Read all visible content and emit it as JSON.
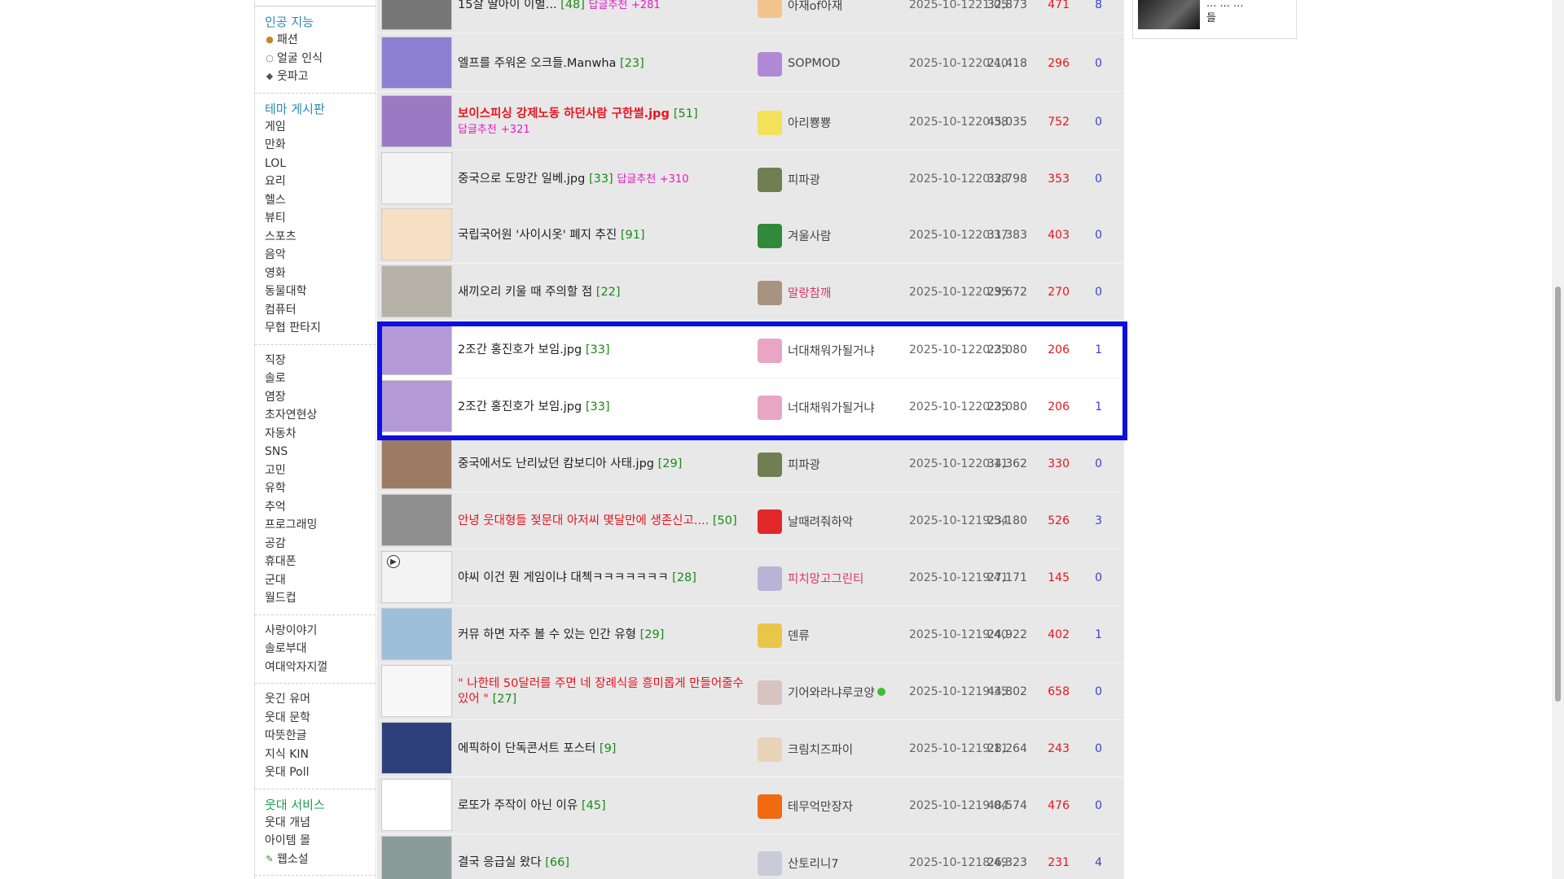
{
  "sidebar": {
    "sections": [
      {
        "title": "인공 지능",
        "title_color": "#2a8ab6",
        "items": [
          {
            "label": "패션",
            "icon": "person-icon"
          },
          {
            "label": "얼굴 인식",
            "icon": "face-outline-icon"
          },
          {
            "label": "웃파고",
            "icon": "ai-icon"
          }
        ]
      },
      {
        "title": "테마 게시판",
        "title_color": "#2a8ab6",
        "items": [
          {
            "label": "게임"
          },
          {
            "label": "만화"
          },
          {
            "label": "LOL"
          },
          {
            "label": "요리"
          },
          {
            "label": "헬스"
          },
          {
            "label": "뷰티"
          },
          {
            "label": "스포츠"
          },
          {
            "label": "음악"
          },
          {
            "label": "영화"
          },
          {
            "label": "동물대학"
          },
          {
            "label": "컴퓨터"
          },
          {
            "label": "무협 판타지"
          }
        ]
      },
      {
        "title": "",
        "items": [
          {
            "label": "직장"
          },
          {
            "label": "솔로"
          },
          {
            "label": "염장"
          },
          {
            "label": "초자연현상"
          },
          {
            "label": "자동차"
          },
          {
            "label": "SNS"
          },
          {
            "label": "고민"
          },
          {
            "label": "유학"
          },
          {
            "label": "추억"
          },
          {
            "label": "프로그래밍"
          },
          {
            "label": "공감"
          },
          {
            "label": "휴대폰"
          },
          {
            "label": "군대"
          },
          {
            "label": "월드컵"
          }
        ]
      },
      {
        "title": "",
        "items": [
          {
            "label": "사랑이야기"
          },
          {
            "label": "솔로부대"
          },
          {
            "label": "여대악자지껄"
          }
        ]
      },
      {
        "title": "",
        "items": [
          {
            "label": "웃긴 유머"
          },
          {
            "label": "웃대 문학"
          },
          {
            "label": "따뜻한글"
          },
          {
            "label": "지식 KIN"
          },
          {
            "label": "웃대 Poll"
          }
        ]
      },
      {
        "title": "웃대 서비스",
        "title_color": "#1c9c52",
        "items": [
          {
            "label": "웃대 개념"
          },
          {
            "label": "아이템 몰"
          },
          {
            "label": "웹소설",
            "icon": "pen-icon"
          }
        ]
      }
    ]
  },
  "posts": [
    {
      "title": "15살 딸아이 이별...",
      "comments": "[48]",
      "rec_label": "답글추천",
      "rec_value": "+281",
      "style": "normal",
      "author": "아재of아재",
      "author_style": "normal",
      "date": "2025-10-12",
      "time": "21:05",
      "views": "32,873",
      "recs": "471",
      "opp": "8",
      "thumb": "#777777",
      "avatar": "#f2c48d"
    },
    {
      "title": "엘프를 주워온 오크들.Manwha",
      "comments": "[23]",
      "rec_label": "",
      "rec_value": "",
      "style": "normal",
      "author": "SOPMOD",
      "author_style": "normal",
      "date": "2025-10-12",
      "time": "20:40",
      "views": "21,418",
      "recs": "296",
      "opp": "0",
      "thumb": "#8d7fd1",
      "avatar": "#b089d6"
    },
    {
      "title": "보이스피싱 강제노동 하던사람 구한썰.jpg",
      "comments": "[51]",
      "rec_label": "답글추천",
      "rec_value": "+321",
      "style": "red-bold",
      "author": "아리뿅뿅",
      "author_style": "normal",
      "date": "2025-10-12",
      "time": "20:38",
      "views": "45,035",
      "recs": "752",
      "opp": "0",
      "thumb": "#9a7ac2",
      "avatar": "#f3e15a"
    },
    {
      "title": "중국으로 도망간 일베.jpg",
      "comments": "[33]",
      "rec_label": "답글추천",
      "rec_value": "+310",
      "style": "normal",
      "author": "피파광",
      "author_style": "normal",
      "date": "2025-10-12",
      "time": "20:38",
      "views": "32,798",
      "recs": "353",
      "opp": "0",
      "thumb": "#f4f4f4",
      "avatar": "#6f7f52"
    },
    {
      "title": "국립국어원 '사이시옷' 폐지 추진",
      "comments": "[91]",
      "rec_label": "",
      "rec_value": "",
      "style": "normal",
      "author": "겨울사람",
      "author_style": "normal",
      "date": "2025-10-12",
      "time": "20:37",
      "views": "31,383",
      "recs": "403",
      "opp": "0",
      "thumb": "#f6dfc3",
      "avatar": "#2f8a3a"
    },
    {
      "title": "새끼오리 키울 때 주의할 점",
      "comments": "[22]",
      "rec_label": "",
      "rec_value": "",
      "style": "normal",
      "author": "말랑참깨",
      "author_style": "pink",
      "date": "2025-10-12",
      "time": "20:35",
      "views": "29,672",
      "recs": "270",
      "opp": "0",
      "thumb": "#b7b2a8",
      "avatar": "#a79380"
    },
    {
      "title": "2조간 홍진호가 보임.jpg",
      "comments": "[33]",
      "rec_label": "",
      "rec_value": "",
      "style": "normal",
      "author": "너대채워가될거냐",
      "author_style": "normal",
      "date": "2025-10-12",
      "time": "20:25",
      "views": "23,080",
      "recs": "206",
      "opp": "1",
      "thumb": "#b39ad6",
      "avatar": "#e8a6c4",
      "highlight": true
    },
    {
      "title": "2조간 홍진호가 보임.jpg",
      "comments": "[33]",
      "rec_label": "",
      "rec_value": "",
      "style": "normal",
      "author": "너대채워가될거냐",
      "author_style": "normal",
      "date": "2025-10-12",
      "time": "20:25",
      "views": "23,080",
      "recs": "206",
      "opp": "1",
      "thumb": "#b39ad6",
      "avatar": "#e8a6c4",
      "highlight": true
    },
    {
      "title": "중국에서도 난리났던 캄보디아 사태.jpg",
      "comments": "[29]",
      "rec_label": "",
      "rec_value": "",
      "style": "normal",
      "author": "피파광",
      "author_style": "normal",
      "date": "2025-10-12",
      "time": "20:11",
      "views": "34,362",
      "recs": "330",
      "opp": "0",
      "thumb": "#9c7b62",
      "avatar": "#6f7f52"
    },
    {
      "title": "안녕 웃대형들 젖문대 아저씨 몇달만에 생존신고....",
      "comments": "[50]",
      "rec_label": "",
      "rec_value": "",
      "style": "red",
      "author": "날때려줘하악",
      "author_style": "normal",
      "date": "2025-10-12",
      "time": "19:54",
      "views": "23,180",
      "recs": "526",
      "opp": "3",
      "thumb": "#8e8e8e",
      "avatar": "#e0282b"
    },
    {
      "title": "야씨 이건 뭔 게임이냐 대첵ㅋㅋㅋㅋㅋㅋㅋ",
      "comments": "[28]",
      "rec_label": "",
      "rec_value": "",
      "style": "normal",
      "author": "피치망고그린티",
      "author_style": "pink",
      "date": "2025-10-12",
      "time": "19:41",
      "views": "27,171",
      "recs": "145",
      "opp": "0",
      "thumb": "#f3f3f3",
      "avatar": "#b9b4d6",
      "play": true
    },
    {
      "title": "커뮤 하면 자주 볼 수 있는 인간 유형",
      "comments": "[29]",
      "rec_label": "",
      "rec_value": "",
      "style": "normal",
      "author": "덴류",
      "author_style": "normal",
      "date": "2025-10-12",
      "time": "19:40",
      "views": "24,922",
      "recs": "402",
      "opp": "1",
      "thumb": "#9dbfd9",
      "avatar": "#e9c64a"
    },
    {
      "title": "\" 나한테 50달러를 주면 네 장례식을 흥미롭게 만들어줄수 있어 \"",
      "comments": "[27]",
      "rec_label": "",
      "rec_value": "",
      "style": "red",
      "author": "기어와라냐루코양",
      "author_style": "normal",
      "date": "2025-10-12",
      "time": "19:35",
      "views": "44,802",
      "recs": "658",
      "opp": "0",
      "thumb": "#f7f7f7",
      "avatar": "#d7c3c0",
      "online": true
    },
    {
      "title": "에픽하이 단독콘서트 포스터",
      "comments": "[9]",
      "rec_label": "",
      "rec_value": "",
      "style": "normal",
      "author": "크림치즈파이",
      "author_style": "normal",
      "date": "2025-10-12",
      "time": "19:11",
      "views": "28,264",
      "recs": "243",
      "opp": "0",
      "thumb": "#2d3f7b",
      "avatar": "#e8d3b6"
    },
    {
      "title": "로또가 주작이 아닌 이유",
      "comments": "[45]",
      "rec_label": "",
      "rec_value": "",
      "style": "normal",
      "author": "테무억만장자",
      "author_style": "normal",
      "date": "2025-10-12",
      "time": "19:04",
      "views": "48,574",
      "recs": "476",
      "opp": "0",
      "thumb": "#ffffff",
      "avatar": "#f06a12"
    },
    {
      "title": "결국 응급실 왔다",
      "comments": "[66]",
      "rec_label": "",
      "rec_value": "",
      "style": "normal",
      "author": "산토리니7",
      "author_style": "normal",
      "date": "2025-10-12",
      "time": "18:49",
      "views": "26,323",
      "recs": "231",
      "opp": "4",
      "thumb": "#8a9a98",
      "avatar": "#c9cbd8"
    }
  ],
  "right_box": {
    "text": "... ... ...\n들"
  },
  "colors": {
    "highlight_border": "#0b10e0",
    "comment_count": "#1a8a1a",
    "reply_rec": "#e619c7",
    "rec_count": "#e8141f",
    "opp_count": "#3a43c8"
  }
}
